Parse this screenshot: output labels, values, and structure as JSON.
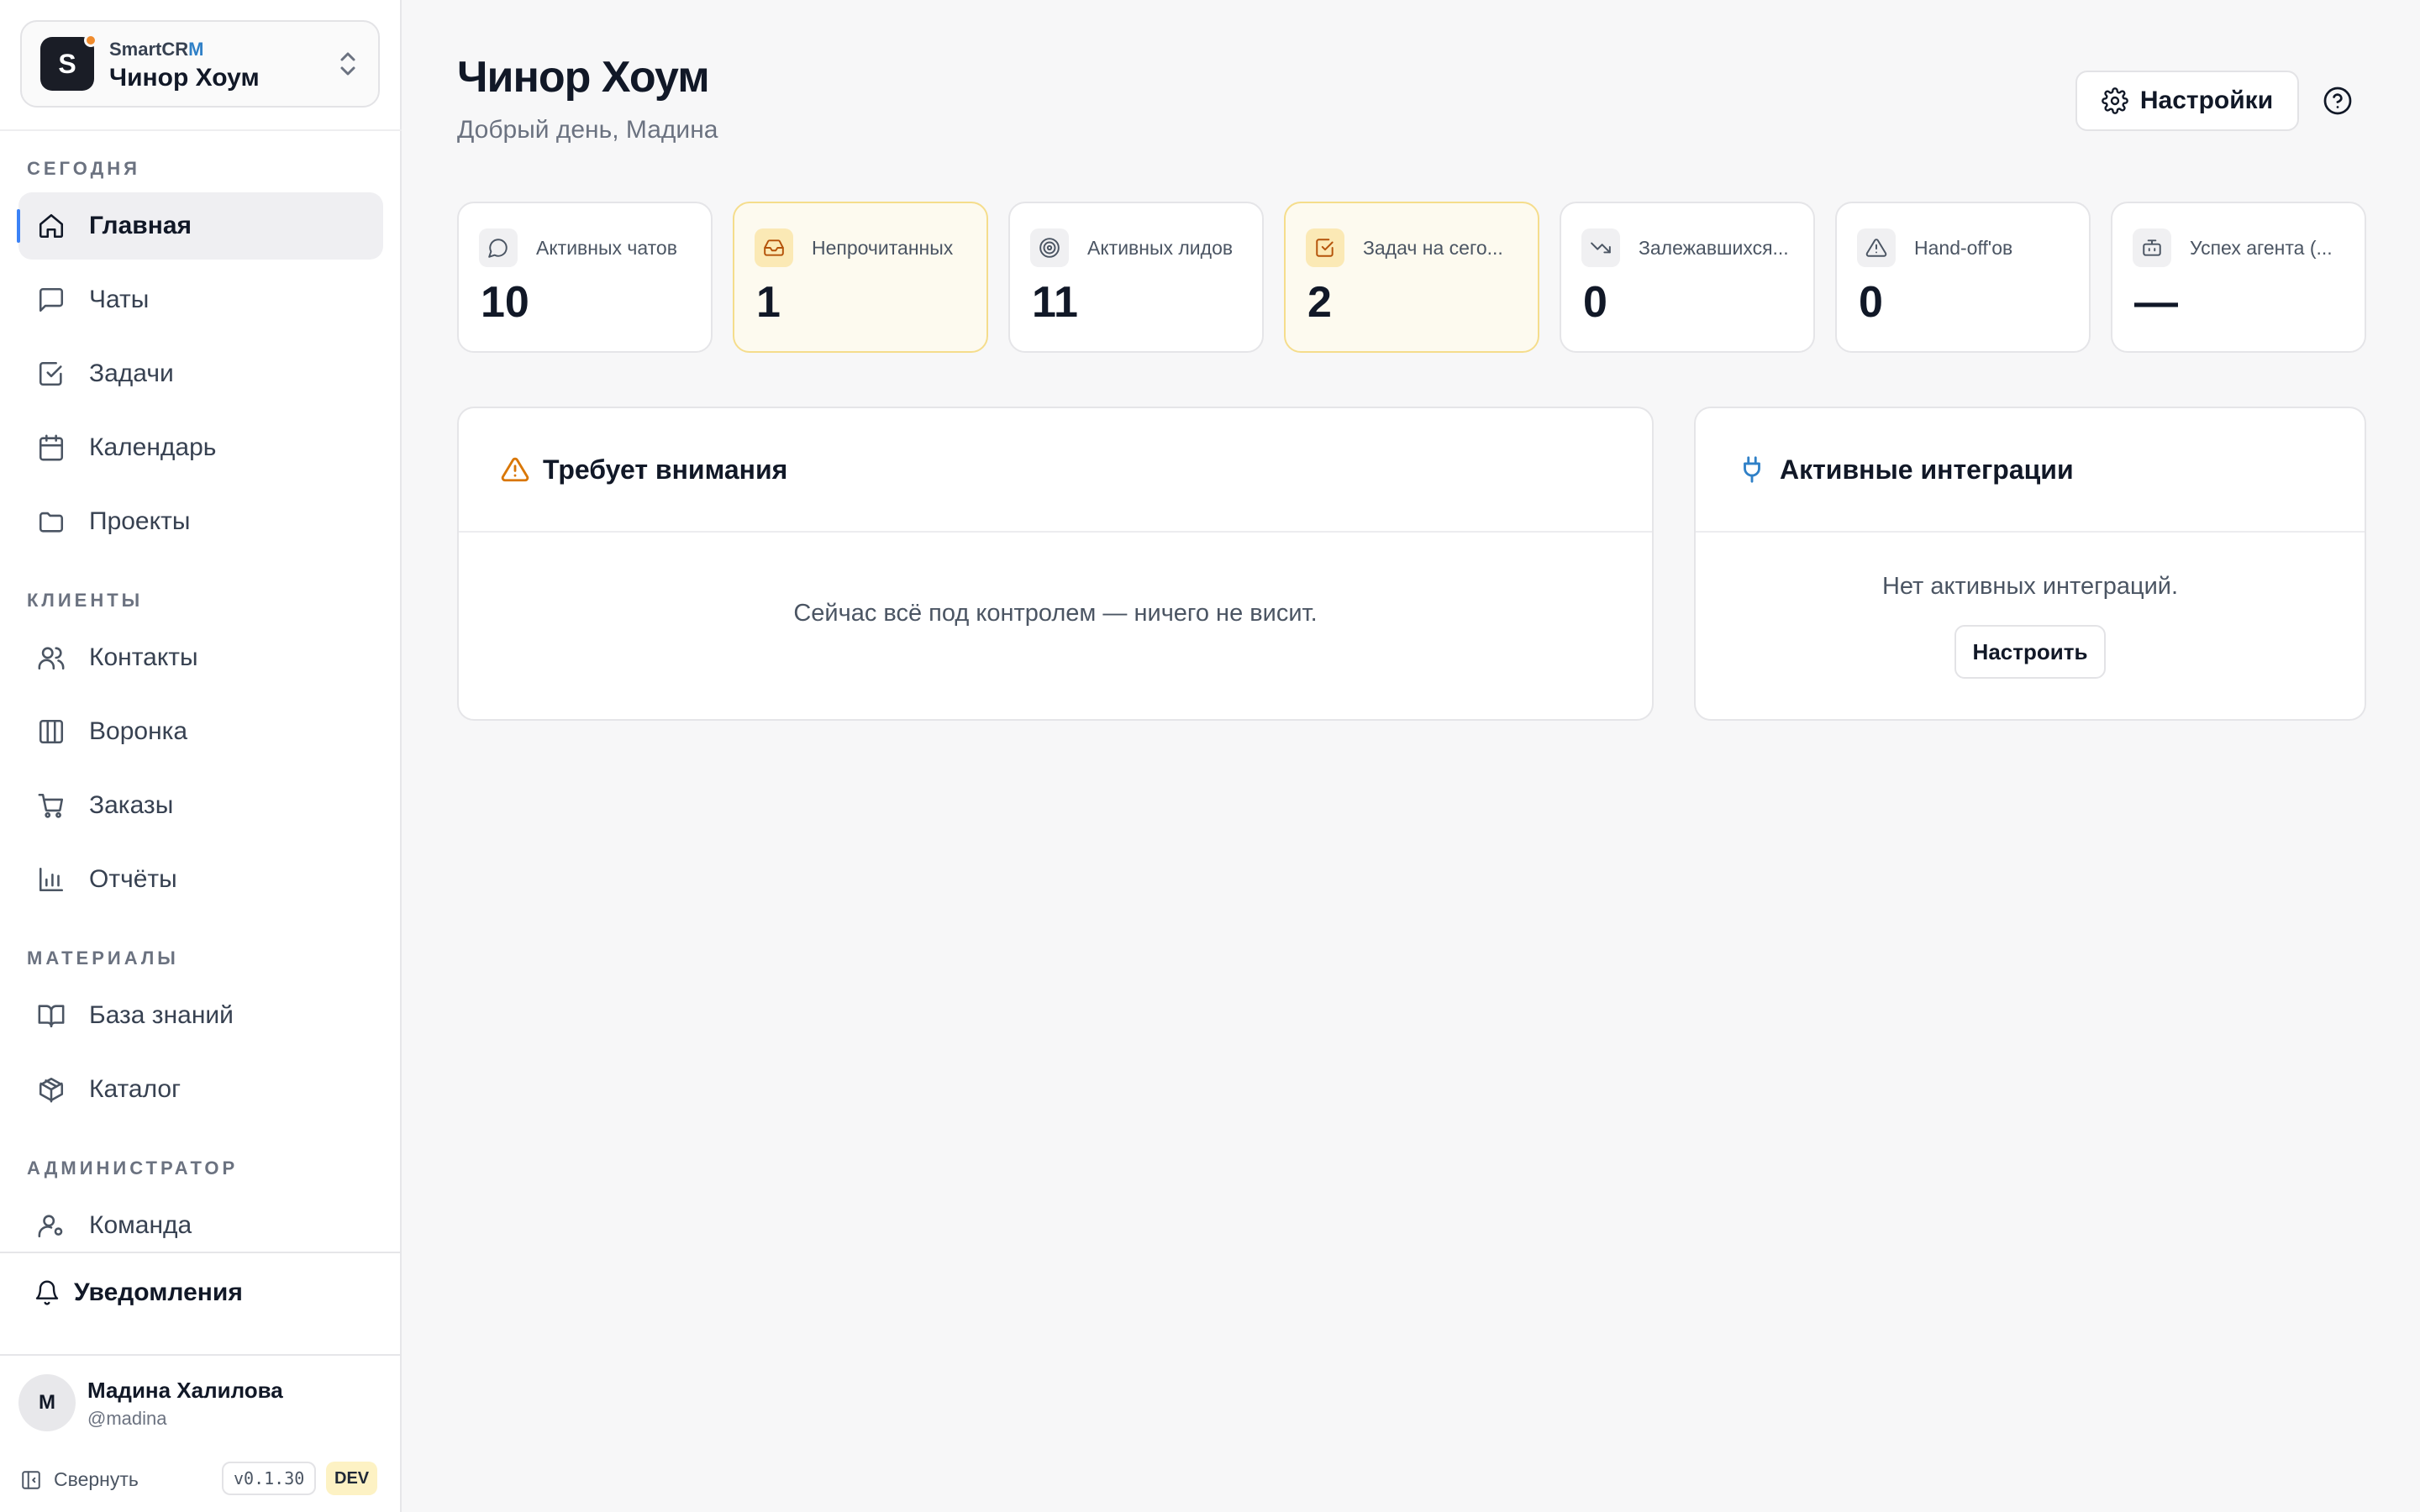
{
  "workspace": {
    "logo_letter": "S",
    "brand_prefix": "SmartCR",
    "brand_accent": "M",
    "name": "Чинор Хоум"
  },
  "sections": {
    "today": "СЕГОДНЯ",
    "clients": "КЛИЕНТЫ",
    "materials": "МАТЕРИАЛЫ",
    "admin": "АДМИНИСТРАТОР"
  },
  "nav": {
    "home": "Главная",
    "chats": "Чаты",
    "tasks": "Задачи",
    "calendar": "Календарь",
    "projects": "Проекты",
    "contacts": "Контакты",
    "funnel": "Воронка",
    "orders": "Заказы",
    "reports": "Отчёты",
    "knowledge": "База знаний",
    "catalog": "Каталог",
    "team": "Команда"
  },
  "notifications_label": "Уведомления",
  "user": {
    "initial": "М",
    "name": "Мадина Халилова",
    "handle": "@madina"
  },
  "footer": {
    "collapse": "Свернуть",
    "version": "v0.1.30",
    "env": "DEV"
  },
  "header": {
    "title": "Чинор Хоум",
    "greeting": "Добрый день, Мадина",
    "settings": "Настройки"
  },
  "stats": [
    {
      "label": "Активных чатов",
      "value": "10",
      "icon": "chat-bubble-icon"
    },
    {
      "label": "Непрочитанных",
      "value": "1",
      "icon": "inbox-icon"
    },
    {
      "label": "Активных лидов",
      "value": "11",
      "icon": "target-icon"
    },
    {
      "label": "Задач на сего...",
      "value": "2",
      "icon": "checkbox-icon"
    },
    {
      "label": "Залежавшихся...",
      "value": "0",
      "icon": "trend-down-icon"
    },
    {
      "label": "Hand-off'ов",
      "value": "0",
      "icon": "warning-icon"
    },
    {
      "label": "Успех агента (...",
      "value": "—",
      "icon": "bot-icon"
    }
  ],
  "attention": {
    "title": "Требует внимания",
    "empty": "Сейчас всё под контролем — ничего не висит."
  },
  "integrations": {
    "title": "Активные интеграции",
    "empty": "Нет активных интеграций.",
    "button": "Настроить"
  },
  "colors": {
    "accent": "#3b82f6",
    "warning_bg": "#fdfaef",
    "warning_border": "#f5dd8c",
    "brand_dot": "#f08c2e"
  }
}
